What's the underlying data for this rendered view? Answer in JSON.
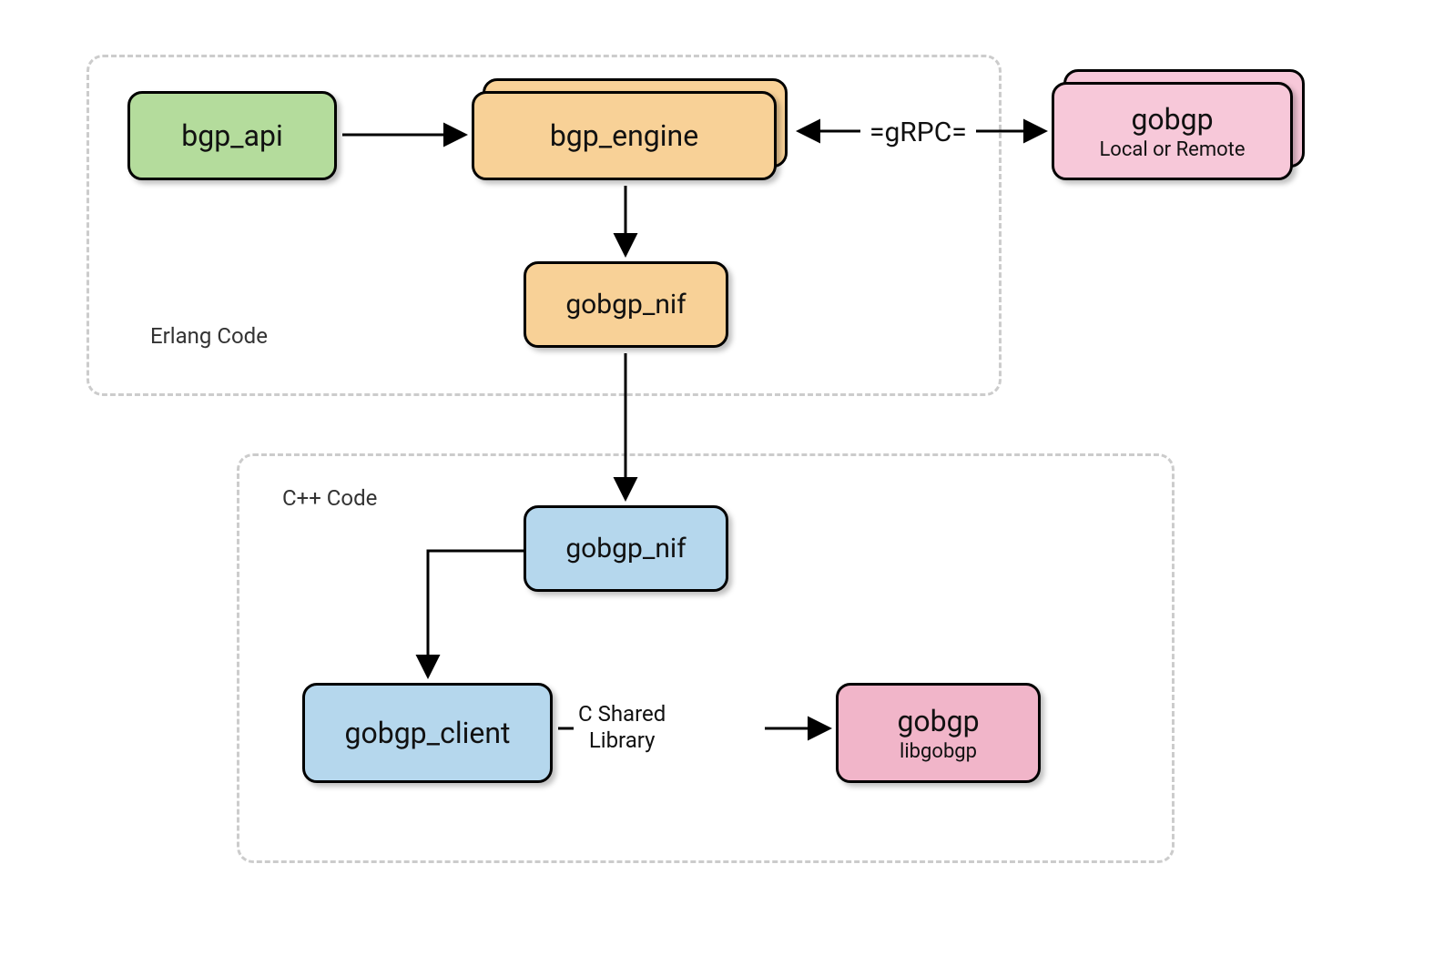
{
  "containers": {
    "erlang": {
      "label": "Erlang Code"
    },
    "cpp": {
      "label": "C++ Code"
    }
  },
  "nodes": {
    "bgp_api": {
      "title": "bgp_api"
    },
    "bgp_engine": {
      "title": "bgp_engine"
    },
    "gobgp_nif_erl": {
      "title": "gobgp_nif"
    },
    "gobgp_remote": {
      "title": "gobgp",
      "subtitle": "Local or Remote"
    },
    "gobgp_nif_cpp": {
      "title": "gobgp_nif"
    },
    "gobgp_client": {
      "title": "gobgp_client"
    },
    "gobgp_lib": {
      "title": "gobgp",
      "subtitle": "libgobgp"
    }
  },
  "edges": {
    "grpc": {
      "label": "=gRPC="
    },
    "cshared": {
      "line1": "C Shared",
      "line2": "Library"
    }
  },
  "colors": {
    "green": "#b4dc9c",
    "orange": "#f8d197",
    "blue": "#b5d7ed",
    "pink": "#f1b5c9"
  }
}
